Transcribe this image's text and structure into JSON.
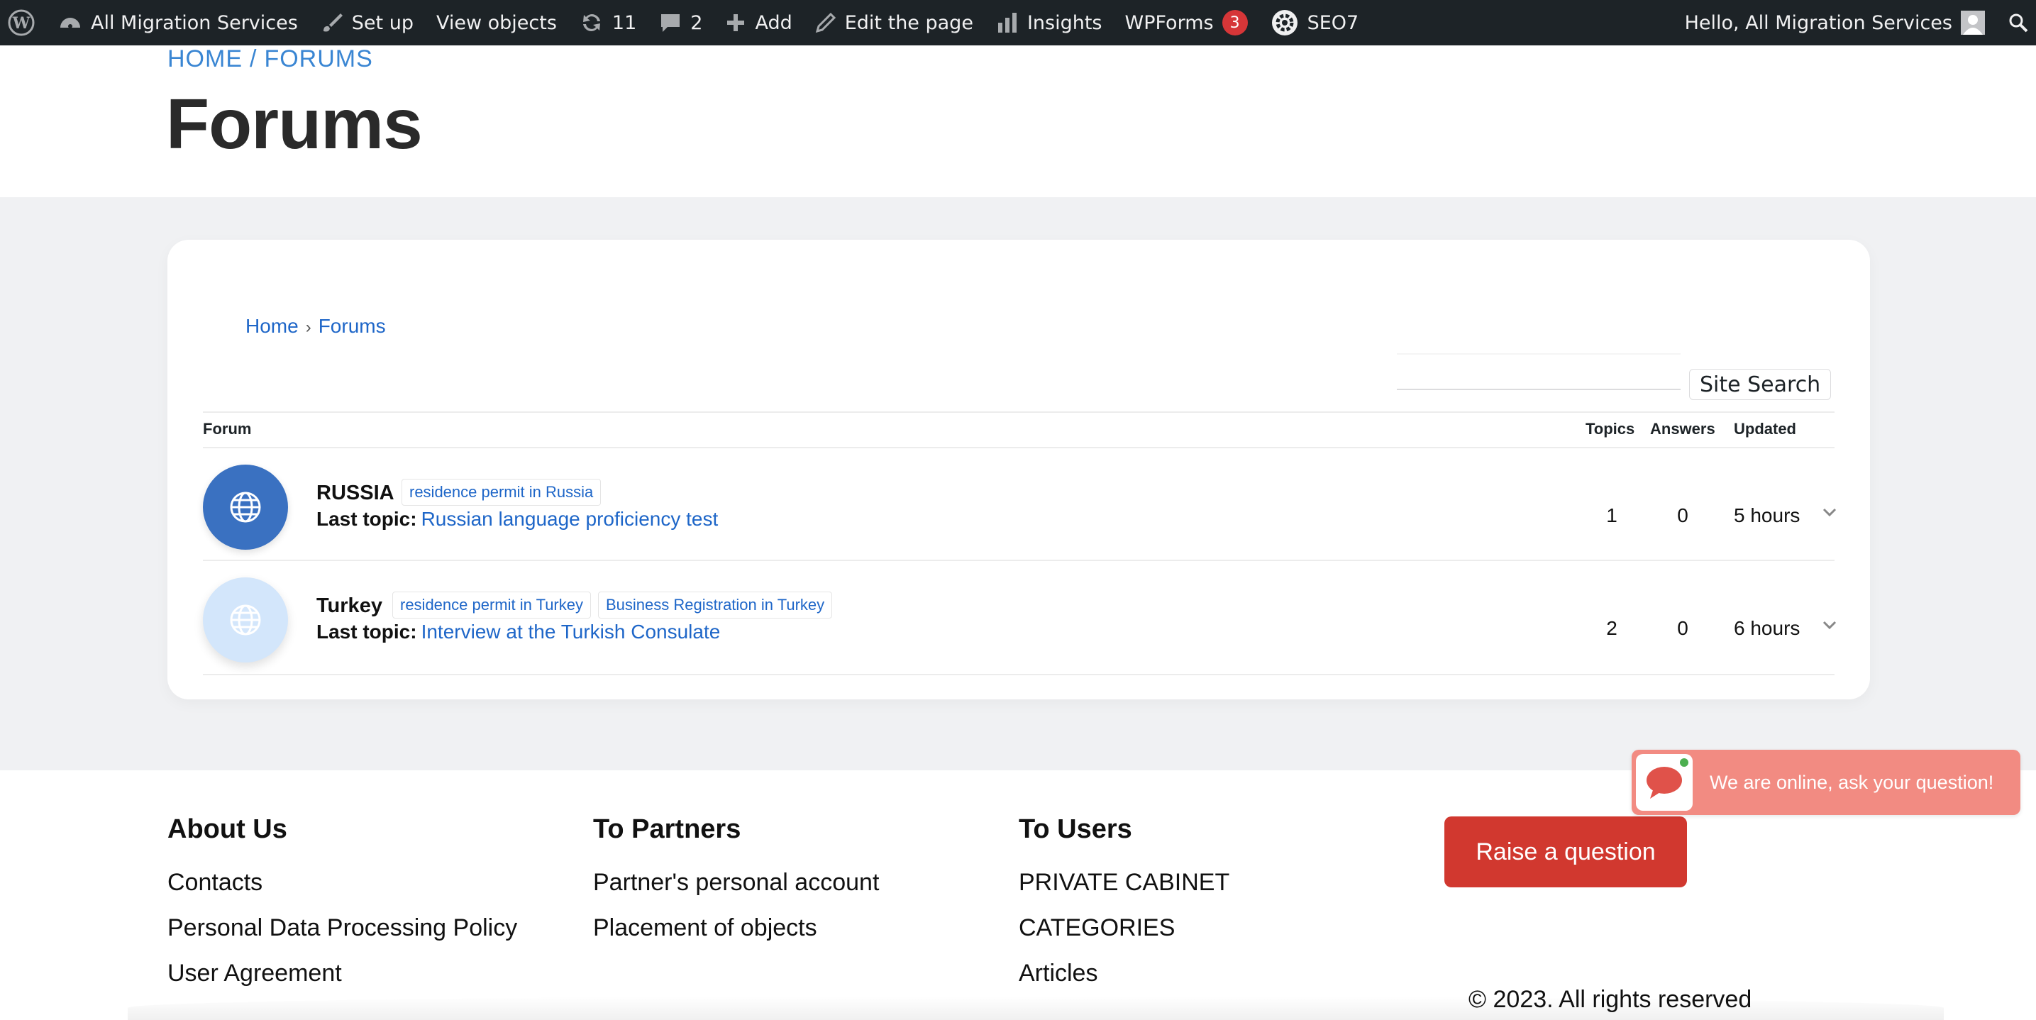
{
  "adminbar": {
    "site_name": "All Migration Services",
    "setup_label": "Set up",
    "view_objects_label": "View objects",
    "updates_count": "11",
    "comments_count": "2",
    "add_label": "Add",
    "edit_label": "Edit the page",
    "insights_label": "Insights",
    "wpforms_label": "WPForms",
    "wpforms_badge": "3",
    "seo_label": "SEO7",
    "greeting": "Hello, All Migration Services"
  },
  "hero": {
    "crumb_home": "HOME",
    "crumb_sep": "/",
    "crumb_current": "FORUMS",
    "title": "Forums"
  },
  "forum": {
    "crumb_home": "Home",
    "crumb_sep": "›",
    "crumb_current": "Forums",
    "search_button": "Site Search",
    "headers": {
      "forum": "Forum",
      "topics": "Topics",
      "answers": "Answers",
      "updated": "Updated"
    },
    "last_topic_label": "Last topic:",
    "rows": [
      {
        "name": "RUSSIA",
        "tags": [
          "residence permit in Russia"
        ],
        "last_topic": "Russian language proficiency test",
        "topics": "1",
        "answers": "0",
        "updated": "5 hours"
      },
      {
        "name": "Turkey",
        "tags": [
          "residence permit in Turkey",
          "Business Registration in Turkey"
        ],
        "last_topic": "Interview at the Turkish Consulate",
        "topics": "2",
        "answers": "0",
        "updated": "6 hours"
      }
    ]
  },
  "footer": {
    "about": {
      "title": "About Us",
      "links": [
        "Contacts",
        "Personal Data Processing Policy",
        "User Agreement"
      ]
    },
    "partners": {
      "title": "To Partners",
      "links": [
        "Partner's personal account",
        "Placement of objects"
      ]
    },
    "users": {
      "title": "To Users",
      "links": [
        "PRIVATE CABINET",
        "CATEGORIES",
        "Articles"
      ]
    },
    "raise_button": "Raise a question",
    "copyright": "© 2023. All rights reserved"
  },
  "chat": {
    "text": "We are online, ask your question!"
  },
  "colors": {
    "adminbar_bg": "#1d2327",
    "link_blue": "#1e66c8",
    "hero_crumb": "#3a86d3",
    "russia_avatar": "#3a71c1",
    "turkey_avatar": "#d3e6fb",
    "raise_button": "#d1382f",
    "chat_bg": "#f28b82"
  },
  "icons": [
    "wordpress-icon",
    "dashboard-icon",
    "brush-icon",
    "update-icon",
    "comment-icon",
    "plus-icon",
    "pencil-icon",
    "bar-chart-icon",
    "seo-gear-icon",
    "user-avatar-icon",
    "search-icon",
    "globe-icon",
    "chevron-down-icon",
    "chat-bubble-icon"
  ]
}
